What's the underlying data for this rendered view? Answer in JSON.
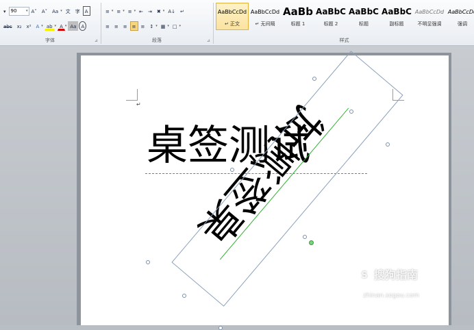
{
  "ribbon": {
    "font_group": {
      "label": "字体",
      "font_size": "90",
      "row1_buttons": [
        "A˄",
        "A˅",
        "Aa",
        "文",
        "字",
        "A"
      ],
      "row2_buttons": [
        "abc",
        "x₂",
        "x²",
        "A",
        "ab",
        "A",
        "Aa",
        "A",
        "字"
      ]
    },
    "paragraph_group": {
      "label": "段落",
      "row1_buttons": [
        "≡",
        "≡",
        "≡",
        "⇤",
        "⇥",
        "✖",
        "A↓",
        "↵"
      ],
      "row2_buttons": [
        "≡",
        "≡",
        "≡",
        "≡",
        "≡",
        "↕",
        "▦",
        "□"
      ]
    },
    "styles_group": {
      "label": "样式",
      "items": [
        {
          "preview": "AaBbCcDd",
          "name": "↵ 正文"
        },
        {
          "preview": "AaBbCcDd",
          "name": "↵ 无间隔"
        },
        {
          "preview": "AaBb",
          "name": "标题 1"
        },
        {
          "preview": "AaBbC",
          "name": "标题 2"
        },
        {
          "preview": "AaBbC",
          "name": "标题"
        },
        {
          "preview": "AaBbC",
          "name": "副标题"
        },
        {
          "preview": "AaBbCcDd",
          "name": "不明显强调"
        },
        {
          "preview": "AaBbCcDd",
          "name": "强调"
        }
      ]
    }
  },
  "document": {
    "paragraph_mark": "↵",
    "main_text": "桌签测试",
    "rotated_text": "桌签测试"
  },
  "watermark": {
    "brand": "搜狗指南",
    "logo_glyph": "S",
    "url": "zhinan.sogou.com"
  },
  "colors": {
    "ribbon_bg": "#eef1f5",
    "selected_style": "#fbe3a0",
    "workspace_bg": "#bfc4ca",
    "baseline_green": "#2fae2f",
    "frame_border": "#8aa0bb"
  }
}
